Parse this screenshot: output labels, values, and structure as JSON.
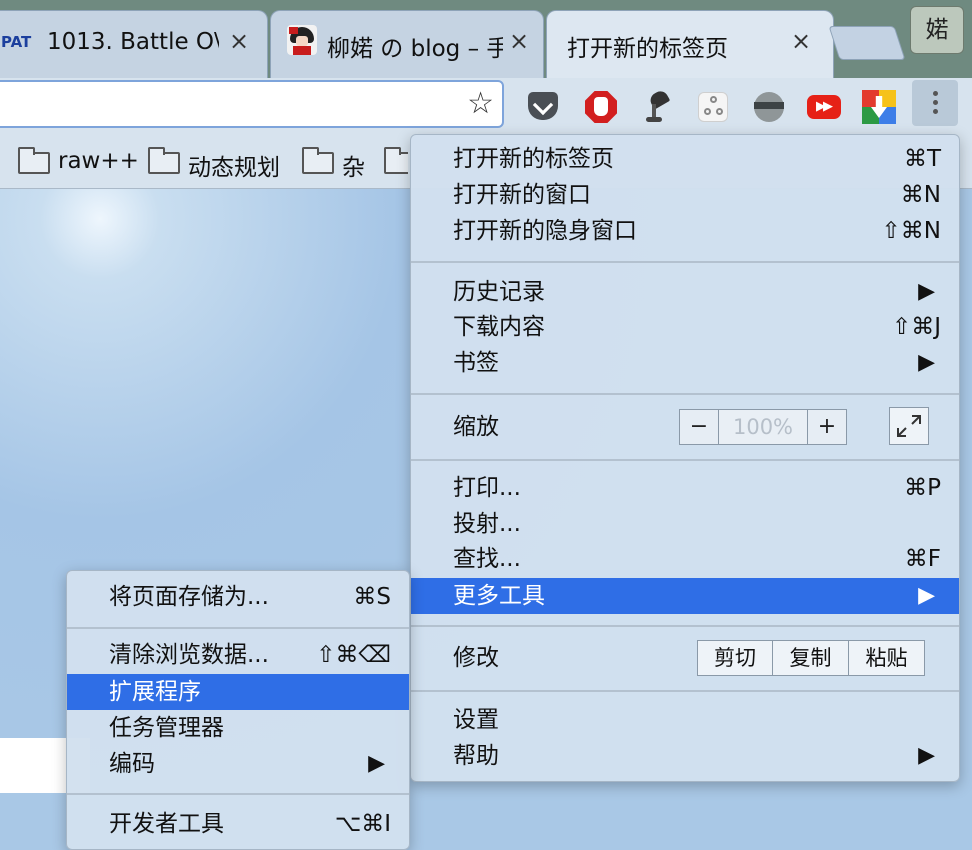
{
  "tabs": [
    {
      "favicon": "PAT",
      "title": "1013. Battle O\\",
      "close": "×"
    },
    {
      "title": "柳婼 の blog – 手",
      "close": "×"
    },
    {
      "title": "打开新的标签页",
      "close": "×"
    }
  ],
  "profile": {
    "label": "婼"
  },
  "toolbar": {
    "bookmark_star": "☆"
  },
  "bookmarks": [
    {
      "label": "raw++"
    },
    {
      "label": "动态规划"
    },
    {
      "label": "杂"
    }
  ],
  "main_menu": {
    "new_tab": {
      "label": "打开新的标签页",
      "shortcut": "⌘T"
    },
    "new_window": {
      "label": "打开新的窗口",
      "shortcut": "⌘N"
    },
    "new_incognito": {
      "label": "打开新的隐身窗口",
      "shortcut": "⇧⌘N"
    },
    "history": {
      "label": "历史记录",
      "arrow": "▶"
    },
    "downloads": {
      "label": "下载内容",
      "shortcut": "⇧⌘J"
    },
    "bookmarks": {
      "label": "书签",
      "arrow": "▶"
    },
    "zoom": {
      "label": "缩放",
      "minus": "−",
      "value": "100%",
      "plus": "+"
    },
    "print": {
      "label": "打印...",
      "shortcut": "⌘P"
    },
    "cast": {
      "label": "投射..."
    },
    "find": {
      "label": "查找...",
      "shortcut": "⌘F"
    },
    "more_tools": {
      "label": "更多工具",
      "arrow": "▶"
    },
    "edit": {
      "label": "修改",
      "cut": "剪切",
      "copy": "复制",
      "paste": "粘贴"
    },
    "settings": {
      "label": "设置"
    },
    "help": {
      "label": "帮助",
      "arrow": "▶"
    }
  },
  "sub_menu": {
    "save_page": {
      "label": "将页面存储为...",
      "shortcut": "⌘S"
    },
    "clear_data": {
      "label": "清除浏览数据...",
      "shortcut": "⇧⌘⌫"
    },
    "extensions": {
      "label": "扩展程序"
    },
    "task_manager": {
      "label": "任务管理器"
    },
    "encoding": {
      "label": "编码",
      "arrow": "▶"
    },
    "dev_tools": {
      "label": "开发者工具",
      "shortcut": "⌥⌘I"
    }
  },
  "colors": {
    "highlight": "#2f6ee6",
    "menu_bg": "#d2e0ee",
    "omnibox_border": "#7ea4db"
  }
}
